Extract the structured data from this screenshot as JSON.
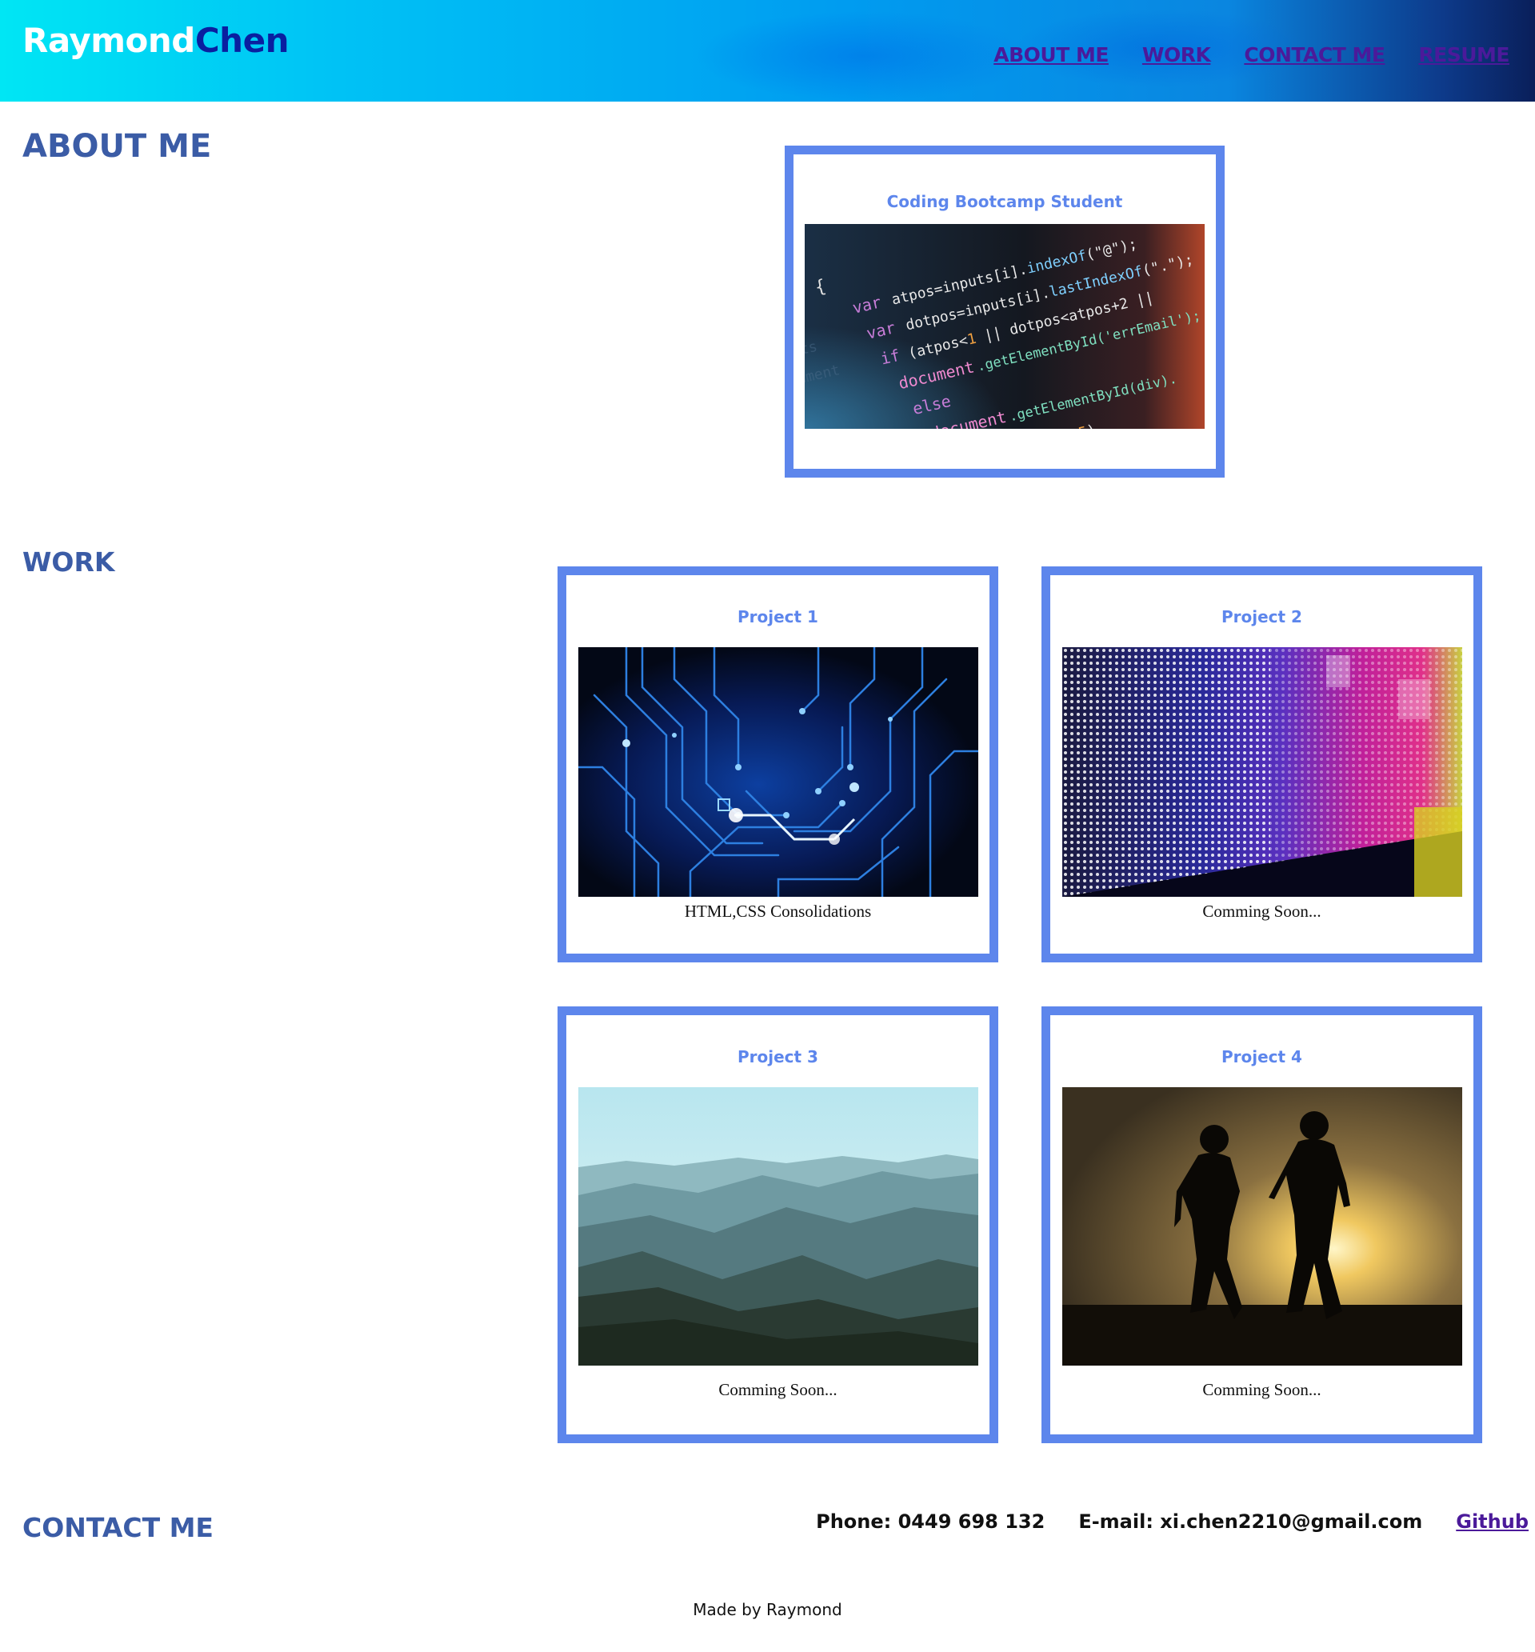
{
  "header": {
    "logo_first": "Raymond",
    "logo_last": "Chen",
    "nav": [
      {
        "label": "ABOUT ME"
      },
      {
        "label": "WORK"
      },
      {
        "label": "CONTACT ME"
      },
      {
        "label": "RESUME"
      }
    ]
  },
  "about": {
    "heading": "ABOUT ME",
    "card_title": "Coding Bootcamp Student"
  },
  "work": {
    "heading": "WORK",
    "projects": [
      {
        "title": "Project 1",
        "caption": "HTML,CSS Consolidations"
      },
      {
        "title": "Project 2",
        "caption": "Comming Soon..."
      },
      {
        "title": "Project 3",
        "caption": "Comming Soon..."
      },
      {
        "title": "Project 4",
        "caption": "Comming Soon..."
      }
    ]
  },
  "contact": {
    "heading": "CONTACT ME",
    "phone": "Phone: 0449 698 132",
    "email": "E-mail: xi.chen2210@gmail.com",
    "github": "Github"
  },
  "footer": {
    "text": "Made by Raymond"
  },
  "colors": {
    "heading": "#3b5ca6",
    "card_border": "#5d86ec",
    "nav_link": "#4b1a9a",
    "logo_dark": "#0a1fa0"
  }
}
